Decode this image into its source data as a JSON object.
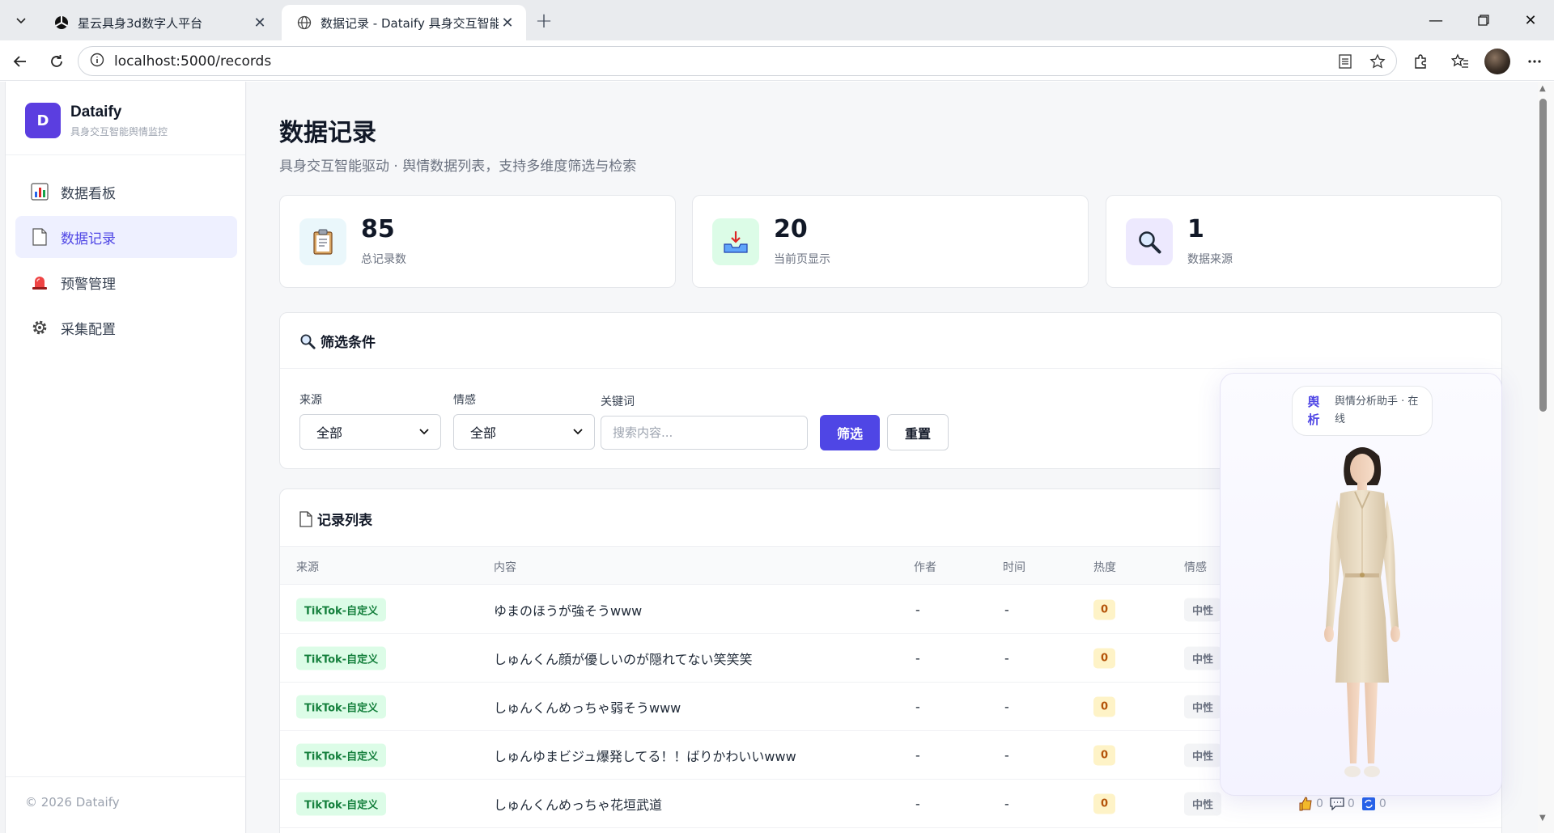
{
  "browser": {
    "tabs": [
      {
        "title": "星云具身3d数字人平台",
        "active": false
      },
      {
        "title": "数据记录 - Dataify 具身交互智能舆",
        "active": true
      }
    ],
    "url": "localhost:5000/records"
  },
  "sidebar": {
    "brand_letter": "D",
    "brand_name": "Dataify",
    "brand_sub": "具身交互智能舆情监控",
    "items": [
      {
        "label": "数据看板",
        "icon": "bar-chart-icon",
        "active": false
      },
      {
        "label": "数据记录",
        "icon": "document-icon",
        "active": true
      },
      {
        "label": "预警管理",
        "icon": "siren-icon",
        "active": false
      },
      {
        "label": "采集配置",
        "icon": "gear-icon",
        "active": false
      }
    ],
    "footer": "© 2026 Dataify"
  },
  "header": {
    "title": "数据记录",
    "subtitle": "具身交互智能驱动 · 舆情数据列表，支持多维度筛选与检索"
  },
  "stats": [
    {
      "value": "85",
      "label": "总记录数",
      "icon": "clipboard-icon",
      "bg": "#eaf7fb"
    },
    {
      "value": "20",
      "label": "当前页显示",
      "icon": "inbox-tray-icon",
      "bg": "#dcfce7"
    },
    {
      "value": "1",
      "label": "数据来源",
      "icon": "magnifier-icon",
      "bg": "#ede9fe"
    }
  ],
  "filters": {
    "title": "筛选条件",
    "source_label": "来源",
    "source_value": "全部",
    "sentiment_label": "情感",
    "sentiment_value": "全部",
    "keyword_label": "关键词",
    "keyword_placeholder": "搜索内容...",
    "filter_button": "筛选",
    "reset_button": "重置"
  },
  "table": {
    "title": "记录列表",
    "columns": [
      "来源",
      "内容",
      "作者",
      "时间",
      "热度",
      "情感"
    ],
    "rows": [
      {
        "source": "TikTok-自定义",
        "content": "ゆまのほうが強そうwww",
        "author": "-",
        "time": "-",
        "heat": "0",
        "sentiment": "中性"
      },
      {
        "source": "TikTok-自定义",
        "content": "しゅんくん顔が優しいのが隠れてない笑笑笑",
        "author": "-",
        "time": "-",
        "heat": "0",
        "sentiment": "中性"
      },
      {
        "source": "TikTok-自定义",
        "content": "しゅんくんめっちゃ弱そうwww",
        "author": "-",
        "time": "-",
        "heat": "0",
        "sentiment": "中性"
      },
      {
        "source": "TikTok-自定义",
        "content": "しゅんゆまビジュ爆発してる！！ばりかわいいwww",
        "author": "-",
        "time": "-",
        "heat": "0",
        "sentiment": "中性"
      },
      {
        "source": "TikTok-自定义",
        "content": "しゅんくんめっちゃ花垣武道",
        "author": "-",
        "time": "-",
        "heat": "0",
        "sentiment": "中性",
        "likes": "0",
        "comments": "0",
        "shares": "0"
      }
    ]
  },
  "assistant": {
    "logo_line1": "舆",
    "logo_line2": "析",
    "status": "舆情分析助手 · 在线"
  },
  "colors": {
    "accent": "#4f46e5",
    "brand": "#5b3ee0",
    "source_tag_bg": "#dcfce7",
    "heat_tag_bg": "#fef3c7"
  }
}
